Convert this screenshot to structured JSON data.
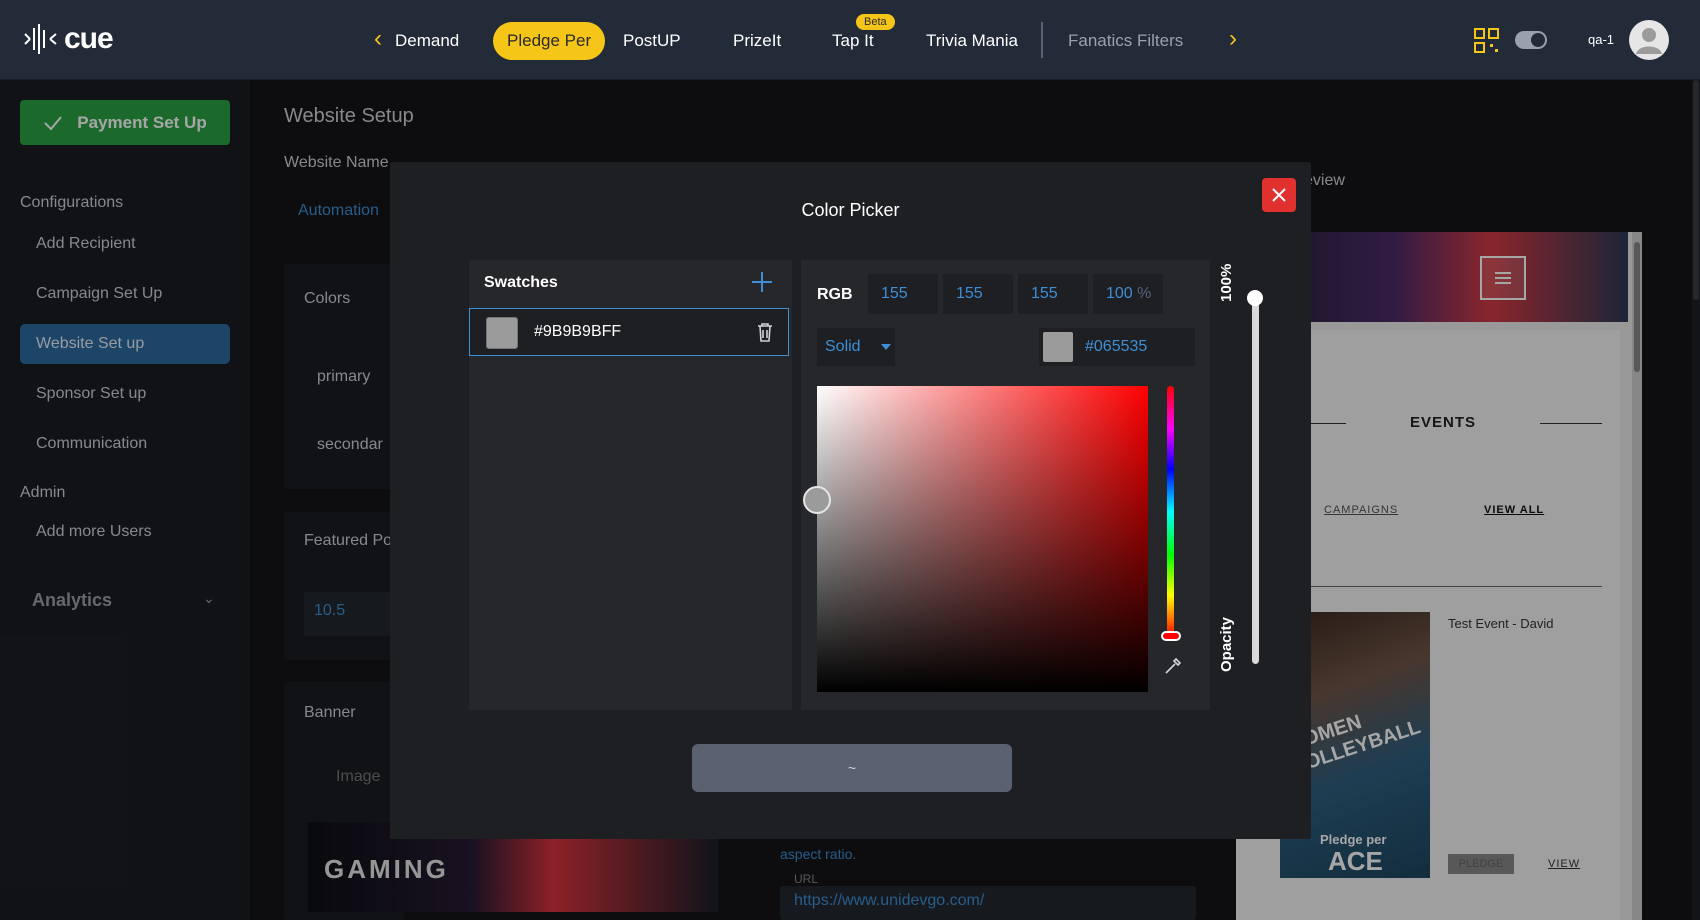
{
  "app": {
    "logo_text": "cue",
    "user_name": "qa-1"
  },
  "nav": {
    "items": [
      {
        "label": "Demand",
        "dim": false,
        "active": false
      },
      {
        "label": "Pledge Per",
        "active": true
      },
      {
        "label": "PostUP"
      },
      {
        "label": "PrizeIt"
      },
      {
        "label": "Tap It"
      },
      {
        "label": "Trivia Mania"
      },
      {
        "label": "Fanatics Filters",
        "dim": true
      }
    ],
    "beta_badge": "Beta",
    "prev_icon": "chevron-left-icon",
    "next_icon": "chevron-right-icon"
  },
  "sidebar": {
    "payment_button": "Payment Set Up",
    "configurations_label": "Configurations",
    "items": [
      {
        "label": "Add Recipient"
      },
      {
        "label": "Campaign Set Up"
      },
      {
        "label": "Website Set up",
        "active": true
      },
      {
        "label": "Sponsor Set up"
      },
      {
        "label": "Communication"
      }
    ],
    "admin_label": "Admin",
    "admin_items": [
      {
        "label": "Add more Users"
      }
    ],
    "analytics_label": "Analytics"
  },
  "main": {
    "title": "Website Setup",
    "website_name_label": "Website Name",
    "website_name_value": "Automation",
    "colors_label": "Colors",
    "primary_label": "primary",
    "secondary_label": "secondar",
    "featured_label": "Featured Po",
    "featured_value": "10.5",
    "banner_label": "Banner",
    "image_radio_label": "Image",
    "banner_text": "GAMING",
    "aspect_text": "aspect ratio.",
    "url_label": "URL",
    "url_value": "https://www.unidevgo.com/",
    "preview_label": "eview"
  },
  "preview": {
    "events_title": "EVENTS",
    "campaigns_link": "CAMPAIGNS",
    "view_all_link": "VIEW ALL",
    "event_title": "Test Event - David",
    "image_text": "WOMEN VOLLEYBALL",
    "pledge_text": "Pledge per",
    "ace_text": "ACE",
    "pledge_btn": "PLEDGE",
    "view_link": "VIEW"
  },
  "color_picker": {
    "title": "Color Picker",
    "swatches_label": "Swatches",
    "swatch_hex": "#9B9B9BFF",
    "swatch_color": "#9b9b9b",
    "rgb_label": "RGB",
    "r": "155",
    "g": "155",
    "b": "155",
    "alpha": "100",
    "alpha_unit": "%",
    "fill_type": "Solid",
    "hex_value": "#065535",
    "opacity_pct": "100%",
    "opacity_label": "Opacity",
    "opacity_value": 1.0,
    "apply_label": "~",
    "colors": {
      "accent": "#3d8fd6",
      "close": "#e0312e",
      "highlight": "#f5c518"
    }
  }
}
